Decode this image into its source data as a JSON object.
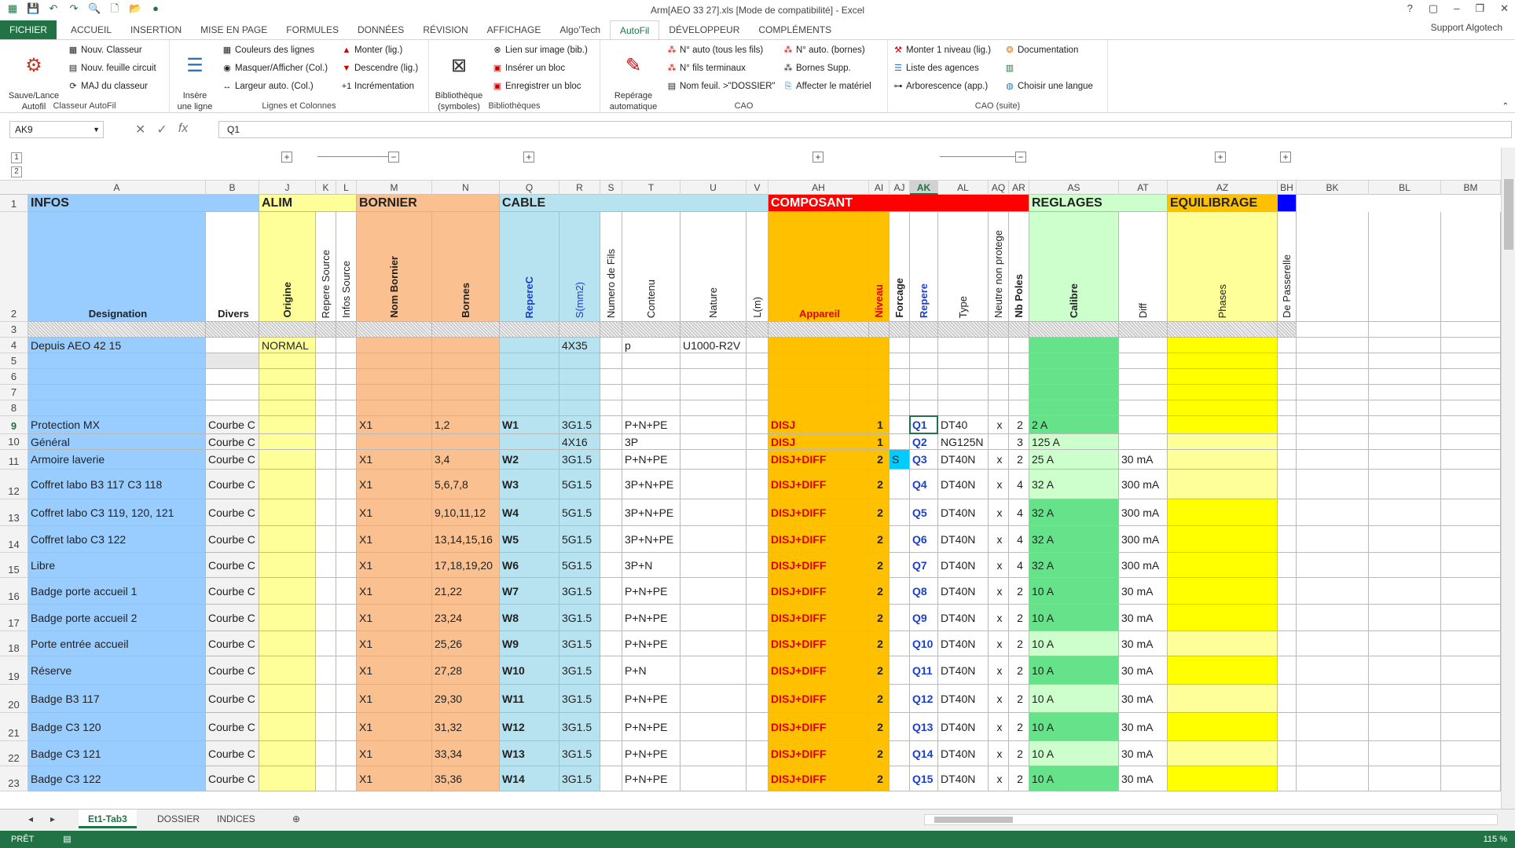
{
  "title": "Arm[AEO 33 27].xls  [Mode de compatibilité] - Excel",
  "window": {
    "help": "?",
    "restore": "▢",
    "min": "–",
    "max": "❐",
    "close": "✕"
  },
  "tabs": [
    "FICHIER",
    "ACCUEIL",
    "INSERTION",
    "MISE EN PAGE",
    "FORMULES",
    "DONNÉES",
    "RÉVISION",
    "AFFICHAGE",
    "Algo'Tech",
    "AutoFil",
    "DÉVELOPPEUR",
    "COMPLÉMENTS"
  ],
  "user": "Support Algotech",
  "ribbon": {
    "g1": {
      "label": "Classeur AutoFil",
      "big": "Sauve/Lance\nAutofil",
      "items": [
        "Nouv. Classeur",
        "Nouv. feuille circuit",
        "MAJ du classeur"
      ]
    },
    "g2": {
      "label": "Lignes et Colonnes",
      "big": "Insère\nune ligne",
      "items": [
        "Couleurs des lignes",
        "Masquer/Afficher (Col.)",
        "Largeur auto. (Col.)",
        "Monter (lig.)",
        "Descendre (lig.)",
        "Incrémentation"
      ]
    },
    "g3": {
      "label": "Bibliothèques",
      "big": "Bibliothèque\n(symboles)",
      "items": [
        "Lien sur image (bib.)",
        "Insérer un bloc",
        "Enregistrer un bloc"
      ]
    },
    "g4": {
      "label": "CAO",
      "big": "Repérage\nautomatique",
      "items": [
        "N° auto (tous les fils)",
        "N° fils terminaux",
        "Nom feuil. >\"DOSSIER\"",
        "N° auto. (bornes)",
        "Bornes Supp.",
        "Affecter le matériel"
      ]
    },
    "g5": {
      "label": "CAO (suite)",
      "items": [
        "Monter 1 niveau (lig.)",
        "Liste des agences",
        "Arborescence (app.)",
        "Documentation",
        "",
        "Choisir une langue"
      ]
    }
  },
  "namebox": "AK9",
  "formula": "Q1",
  "outline": {
    "levels": [
      "1",
      "2"
    ]
  },
  "columns": [
    "A",
    "B",
    "J",
    "K",
    "L",
    "M",
    "N",
    "Q",
    "R",
    "S",
    "T",
    "U",
    "V",
    "AH",
    "AI",
    "AJ",
    "AK",
    "AL",
    "AQ",
    "AR",
    "AS",
    "AT",
    "AZ",
    "BH",
    "BK",
    "BL",
    "BM"
  ],
  "groups": [
    "INFOS",
    "ALIM",
    "BORNIER",
    "CABLE",
    "COMPOSANT",
    "REGLAGES",
    "EQUILIBRAGE"
  ],
  "headers": [
    "Designation",
    "Divers",
    "Origine",
    "Repere Source",
    "Infos Source",
    "Nom Bornier",
    "Bornes",
    "RepereC",
    "S(mm2)",
    "Numero de Fils",
    "Contenu",
    "Nature",
    "L(m)",
    "Appareil",
    "Niveau",
    "Forcage",
    "Repere",
    "Type",
    "Neutre non protege",
    "Nb Poles",
    "Calibre",
    "Diff",
    "Phases",
    "De Passerelle"
  ],
  "row_numbers": [
    "1",
    "2",
    "3",
    "4",
    "5",
    "6",
    "7",
    "8",
    "9",
    "10",
    "11",
    "12",
    "13",
    "14",
    "15",
    "16",
    "17",
    "18",
    "19",
    "20",
    "21",
    "22",
    "23"
  ],
  "rows": [
    [
      "Depuis AEO 42 15",
      "",
      "NORMAL",
      "",
      "",
      "",
      "",
      "",
      "4X35",
      "",
      "p",
      "U1000-R2V",
      "",
      "",
      "",
      "",
      "",
      "",
      "",
      "",
      "",
      "",
      "",
      ""
    ],
    [
      "",
      "",
      "",
      "",
      "",
      "",
      "",
      "",
      "",
      "",
      "",
      "",
      "",
      "",
      "",
      "",
      "",
      "",
      "",
      "",
      "",
      "",
      "",
      ""
    ],
    [
      "",
      "",
      "",
      "",
      "",
      "",
      "",
      "",
      "",
      "",
      "",
      "",
      "",
      "",
      "",
      "",
      "",
      "",
      "",
      "",
      "",
      "",
      "",
      ""
    ],
    [
      "",
      "",
      "",
      "",
      "",
      "",
      "",
      "",
      "",
      "",
      "",
      "",
      "",
      "",
      "",
      "",
      "",
      "",
      "",
      "",
      "",
      "",
      "",
      ""
    ],
    [
      "",
      "",
      "",
      "",
      "",
      "",
      "",
      "",
      "",
      "",
      "",
      "",
      "",
      "",
      "",
      "",
      "",
      "",
      "",
      "",
      "",
      "",
      "",
      ""
    ],
    [
      "Protection MX",
      "Courbe C",
      "",
      "",
      "",
      "X1",
      "1,2",
      "W1",
      "3G1.5",
      "",
      "P+N+PE",
      "",
      "",
      "DISJ",
      "1",
      "",
      "Q1",
      "DT40",
      "x",
      "2",
      "2 A",
      "",
      "",
      ""
    ],
    [
      "Général",
      "Courbe C",
      "",
      "",
      "",
      "",
      "",
      "",
      "4X16",
      "",
      "3P",
      "",
      "",
      "DISJ",
      "1",
      "",
      "Q2",
      "NG125N",
      "",
      "3",
      "125 A",
      "",
      "",
      ""
    ],
    [
      "Armoire laverie",
      "Courbe C",
      "",
      "",
      "",
      "X1",
      "3,4",
      "W2",
      "3G1.5",
      "",
      "P+N+PE",
      "",
      "",
      "DISJ+DIFF",
      "2",
      "S",
      "Q3",
      "DT40N",
      "x",
      "2",
      "25 A",
      "30 mA",
      "",
      ""
    ],
    [
      " Coffret labo B3 117 C3 118",
      "Courbe C",
      "",
      "",
      "",
      "X1",
      "5,6,7,8",
      "W3",
      "5G1.5",
      "",
      "3P+N+PE",
      "",
      "",
      "DISJ+DIFF",
      "2",
      "",
      "Q4",
      "DT40N",
      "x",
      "4",
      "32 A",
      "300 mA",
      "",
      ""
    ],
    [
      " Coffret labo C3 119, 120, 121",
      "Courbe C",
      "",
      "",
      "",
      "X1",
      "9,10,11,12",
      "W4",
      "5G1.5",
      "",
      "3P+N+PE",
      "",
      "",
      "DISJ+DIFF",
      "2",
      "",
      "Q5",
      "DT40N",
      "x",
      "4",
      "32 A",
      "300 mA",
      "",
      ""
    ],
    [
      " Coffret labo C3 122",
      "Courbe C",
      "",
      "",
      "",
      "X1",
      "13,14,15,16",
      "W5",
      "5G1.5",
      "",
      "3P+N+PE",
      "",
      "",
      "DISJ+DIFF",
      "2",
      "",
      "Q6",
      "DT40N",
      "x",
      "4",
      "32 A",
      "300 mA",
      "",
      ""
    ],
    [
      " Libre",
      "Courbe C",
      "",
      "",
      "",
      "X1",
      "17,18,19,20",
      "W6",
      "5G1.5",
      "",
      "3P+N",
      "",
      "",
      "DISJ+DIFF",
      "2",
      "",
      "Q7",
      "DT40N",
      "x",
      "4",
      "32 A",
      "300 mA",
      "",
      ""
    ],
    [
      "Badge porte accueil 1",
      "Courbe C",
      "",
      "",
      "",
      "X1",
      "21,22",
      "W7",
      "3G1.5",
      "",
      "P+N+PE",
      "",
      "",
      "DISJ+DIFF",
      "2",
      "",
      "Q8",
      "DT40N",
      "x",
      "2",
      "10 A",
      "30 mA",
      "",
      ""
    ],
    [
      "Badge porte accueil 2",
      "Courbe C",
      "",
      "",
      "",
      "X1",
      "23,24",
      "W8",
      "3G1.5",
      "",
      "P+N+PE",
      "",
      "",
      "DISJ+DIFF",
      "2",
      "",
      "Q9",
      "DT40N",
      "x",
      "2",
      "10 A",
      "30 mA",
      "",
      ""
    ],
    [
      "Porte entrée accueil",
      "Courbe C",
      "",
      "",
      "",
      "X1",
      "25,26",
      "W9",
      "3G1.5",
      "",
      "P+N+PE",
      "",
      "",
      "DISJ+DIFF",
      "2",
      "",
      "Q10",
      "DT40N",
      "x",
      "2",
      "10 A",
      "30 mA",
      "",
      ""
    ],
    [
      "Réserve",
      "Courbe C",
      "",
      "",
      "",
      "X1",
      "27,28",
      "W10",
      "3G1.5",
      "",
      "P+N",
      "",
      "",
      "DISJ+DIFF",
      "2",
      "",
      "Q11",
      "DT40N",
      "x",
      "2",
      "10 A",
      "30 mA",
      "",
      ""
    ],
    [
      "Badge B3 117",
      "Courbe C",
      "",
      "",
      "",
      "X1",
      "29,30",
      "W11",
      "3G1.5",
      "",
      "P+N+PE",
      "",
      "",
      "DISJ+DIFF",
      "2",
      "",
      "Q12",
      "DT40N",
      "x",
      "2",
      "10 A",
      "30 mA",
      "",
      ""
    ],
    [
      "Badge C3 120",
      "Courbe C",
      "",
      "",
      "",
      "X1",
      "31,32",
      "W12",
      "3G1.5",
      "",
      "P+N+PE",
      "",
      "",
      "DISJ+DIFF",
      "2",
      "",
      "Q13",
      "DT40N",
      "x",
      "2",
      "10 A",
      "30 mA",
      "",
      ""
    ],
    [
      "Badge C3 121",
      "Courbe C",
      "",
      "",
      "",
      "X1",
      "33,34",
      "W13",
      "3G1.5",
      "",
      "P+N+PE",
      "",
      "",
      "DISJ+DIFF",
      "2",
      "",
      "Q14",
      "DT40N",
      "x",
      "2",
      "10 A",
      "30 mA",
      "",
      ""
    ],
    [
      "Badge C3 122",
      "Courbe C",
      "",
      "",
      "",
      "X1",
      "35,36",
      "W14",
      "3G1.5",
      "",
      "P+N+PE",
      "",
      "",
      "DISJ+DIFF",
      "2",
      "",
      "Q15",
      "DT40N",
      "x",
      "2",
      "10 A",
      "30 mA",
      "",
      ""
    ]
  ],
  "sheets": [
    "Et1-Tab3",
    "DOSSIER",
    "INDICES"
  ],
  "status": "PRÊT",
  "zoom": "115 %",
  "colors": {
    "excel_green": "#217346",
    "infos": "#99ccff",
    "alim": "#ffff99",
    "bornier": "#fac090",
    "cable": "#b7e3f0",
    "composant": "#ff0000",
    "reglages": "#ccffcc",
    "equilibrage": "#ffc000"
  }
}
